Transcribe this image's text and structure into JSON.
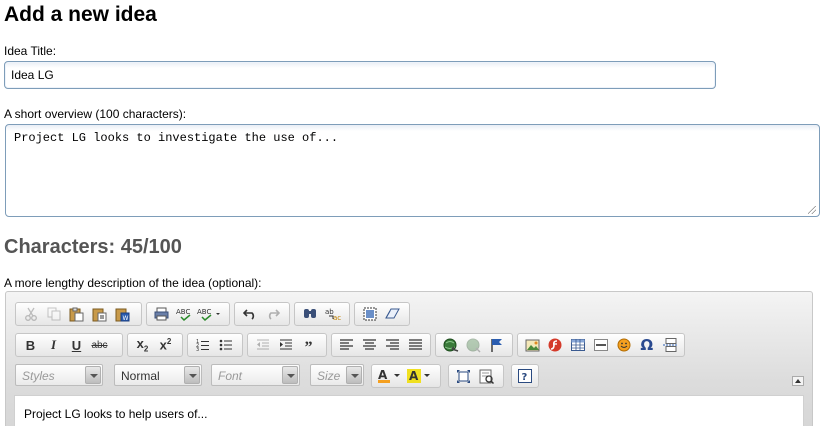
{
  "page": {
    "title": "Add a new idea"
  },
  "idea_title": {
    "label": "Idea Title:",
    "value": "Idea LG"
  },
  "overview": {
    "label": "A short overview (100 characters):",
    "value": "Project LG looks to investigate the use of..."
  },
  "counter": {
    "text": "Characters: 45/100",
    "used": 45,
    "max": 100
  },
  "description": {
    "label": "A more lengthy description of the idea (optional):"
  },
  "editor": {
    "combos": {
      "styles": "Styles",
      "format": "Normal",
      "font": "Font",
      "size": "Size"
    },
    "content": "Project LG looks to help users of...",
    "toolbar_icons": [
      "cut-icon",
      "copy-icon",
      "paste-icon",
      "paste-text-icon",
      "paste-word-icon",
      "print-icon",
      "spellcheck-icon",
      "spellcheck-as-you-type-icon",
      "undo-icon",
      "redo-icon",
      "find-icon",
      "replace-icon",
      "select-all-icon",
      "remove-format-icon",
      "bold-icon",
      "italic-icon",
      "underline-icon",
      "strikethrough-icon",
      "subscript-icon",
      "superscript-icon",
      "numbered-list-icon",
      "bulleted-list-icon",
      "outdent-icon",
      "indent-icon",
      "blockquote-icon",
      "align-left-icon",
      "align-center-icon",
      "align-right-icon",
      "justify-icon",
      "link-icon",
      "unlink-icon",
      "anchor-icon",
      "image-icon",
      "flash-icon",
      "table-icon",
      "horizontal-rule-icon",
      "smiley-icon",
      "special-char-icon",
      "page-break-icon",
      "text-color-icon",
      "background-color-icon",
      "maximize-icon",
      "show-blocks-icon",
      "about-icon"
    ]
  }
}
